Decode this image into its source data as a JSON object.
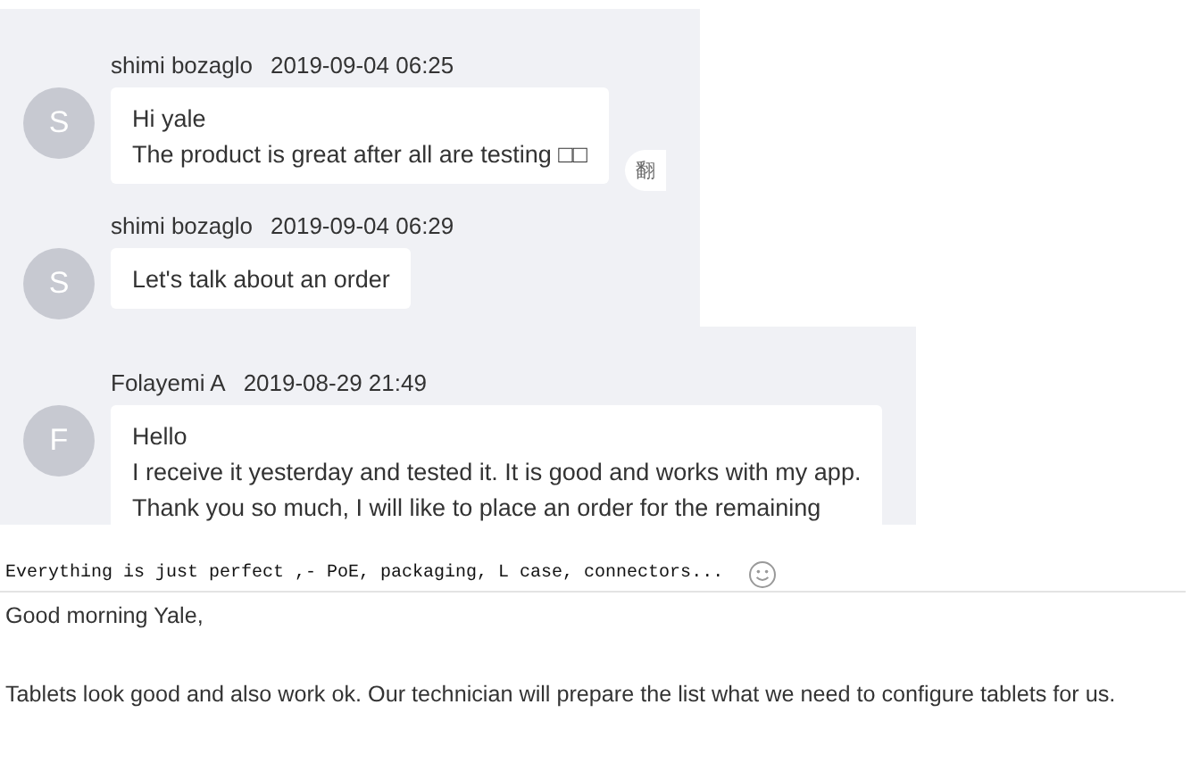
{
  "chat_top": {
    "messages": [
      {
        "avatar": "S",
        "sender": "shimi bozaglo",
        "time": "2019-09-04 06:25",
        "lines": [
          "Hi yale",
          "The product is great after all are testing □□"
        ],
        "translate": "翻"
      },
      {
        "avatar": "S",
        "sender": "shimi bozaglo",
        "time": "2019-09-04 06:29",
        "lines": [
          "Let's talk about an order"
        ]
      }
    ]
  },
  "chat_middle": {
    "messages": [
      {
        "avatar": "F",
        "sender": "Folayemi A",
        "time": "2019-08-29 21:49",
        "lines": [
          "Hello",
          "I receive it yesterday and tested it. It is good and works with my app.",
          "Thank you so much, I will like to place an order for the remaining"
        ]
      }
    ]
  },
  "comment": {
    "text": "Everything is just perfect ,- PoE, packaging, L case, connectors..."
  },
  "email": {
    "greeting": "Good morning Yale,",
    "body": "Tablets look good and also work ok. Our technician will prepare the list what we need to configure tablets for us."
  }
}
